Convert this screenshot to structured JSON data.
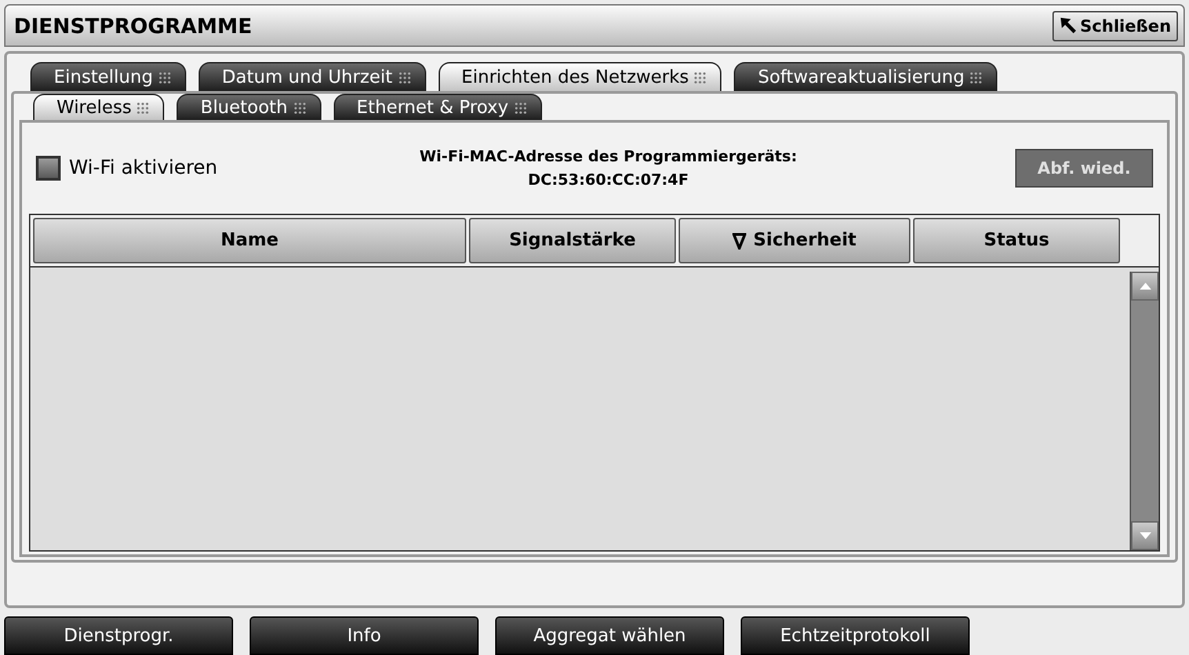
{
  "window": {
    "title": "DIENSTPROGRAMME",
    "close_button": "Schließen"
  },
  "tabs": [
    {
      "label": "Einstellung",
      "selected": false
    },
    {
      "label": "Datum und Uhrzeit",
      "selected": false
    },
    {
      "label": "Einrichten des Netzwerks",
      "selected": true
    },
    {
      "label": "Softwareaktualisierung",
      "selected": false
    }
  ],
  "subtabs": [
    {
      "label": "Wireless",
      "selected": true
    },
    {
      "label": "Bluetooth",
      "selected": false
    },
    {
      "label": "Ethernet & Proxy",
      "selected": false
    }
  ],
  "wifi_checkbox": {
    "label": "Wi-Fi aktivieren",
    "checked": false
  },
  "mac": {
    "label": "Wi-Fi-MAC-Adresse des Programmiergeräts:",
    "value": "DC:53:60:CC:07:4F"
  },
  "refresh_button": {
    "label": "Abf. wied.",
    "disabled": true
  },
  "table": {
    "columns": [
      {
        "label": "Name",
        "sorted": false
      },
      {
        "label": "Signalstärke",
        "sorted": false
      },
      {
        "label": "Sicherheit",
        "sorted": true
      },
      {
        "label": "Status",
        "sorted": false
      }
    ]
  },
  "bottom_buttons": [
    "Dienstprogr.",
    "Info",
    "Aggregat wählen",
    "Echtzeitprotokoll"
  ]
}
